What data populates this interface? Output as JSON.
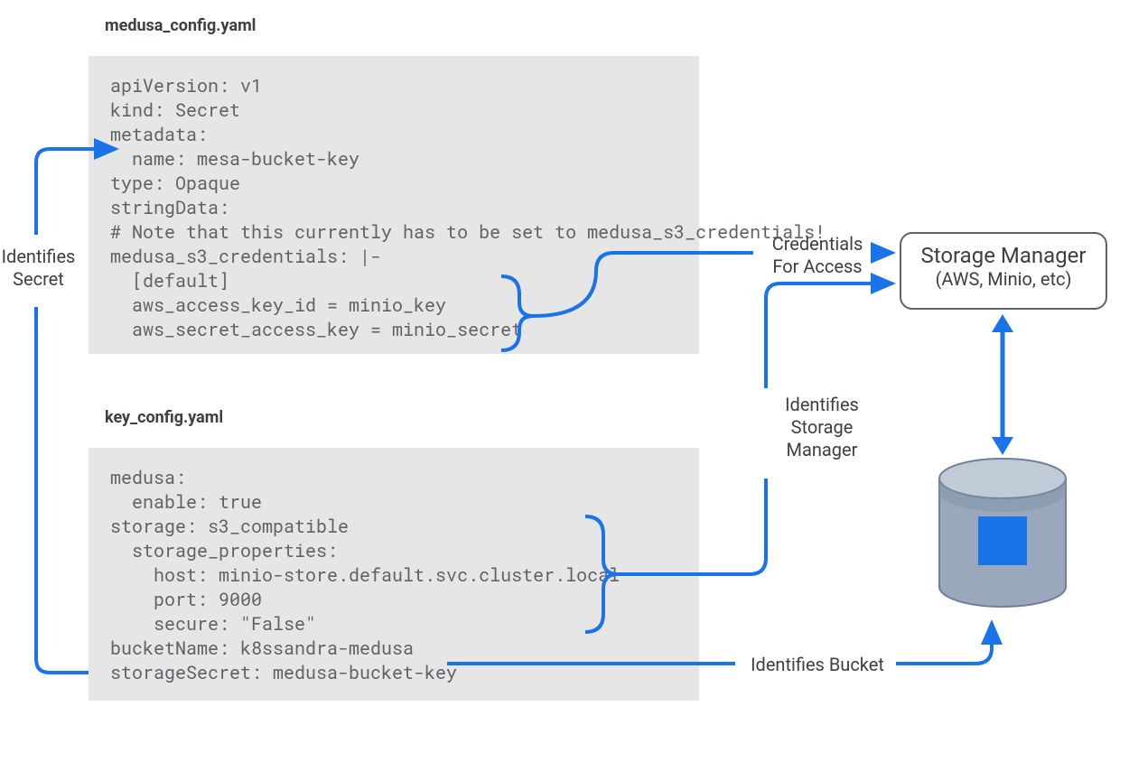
{
  "files": {
    "medusa_config": {
      "title": "medusa_config.yaml",
      "code": "apiVersion: v1\nkind: Secret\nmetadata:\n  name: mesa-bucket-key\ntype: Opaque\nstringData:\n# Note that this currently has to be set to medusa_s3_credentials!\nmedusa_s3_credentials: |-\n  [default]\n  aws_access_key_id = minio_key\n  aws_secret_access_key = minio_secret"
    },
    "key_config": {
      "title": "key_config.yaml",
      "code": "medusa:\n  enable: true\nstorage: s3_compatible\n  storage_properties:\n    host: minio-store.default.svc.cluster.local\n    port: 9000\n    secure: \"False\"\nbucketName: k8ssandra-medusa\nstorageSecret: medusa-bucket-key"
    }
  },
  "storage_manager": {
    "title": "Storage Manager",
    "subtitle": "(AWS, Minio, etc)"
  },
  "annotations": {
    "identifies_secret": "Identifies\nSecret",
    "credentials_for_access": "Credentials\nFor Access",
    "identifies_storage_manager": "Identifies\nStorage\nManager",
    "identifies_bucket": "Identifies Bucket"
  },
  "colors": {
    "arrow": "#1a73e8",
    "code_bg": "#e6e6e6",
    "text": "#3c4043",
    "code_text": "#5f6368",
    "cylinder_fill": "#9aa8bc",
    "cylinder_stroke": "#6e7f99",
    "inner_square": "#1a73e8"
  }
}
